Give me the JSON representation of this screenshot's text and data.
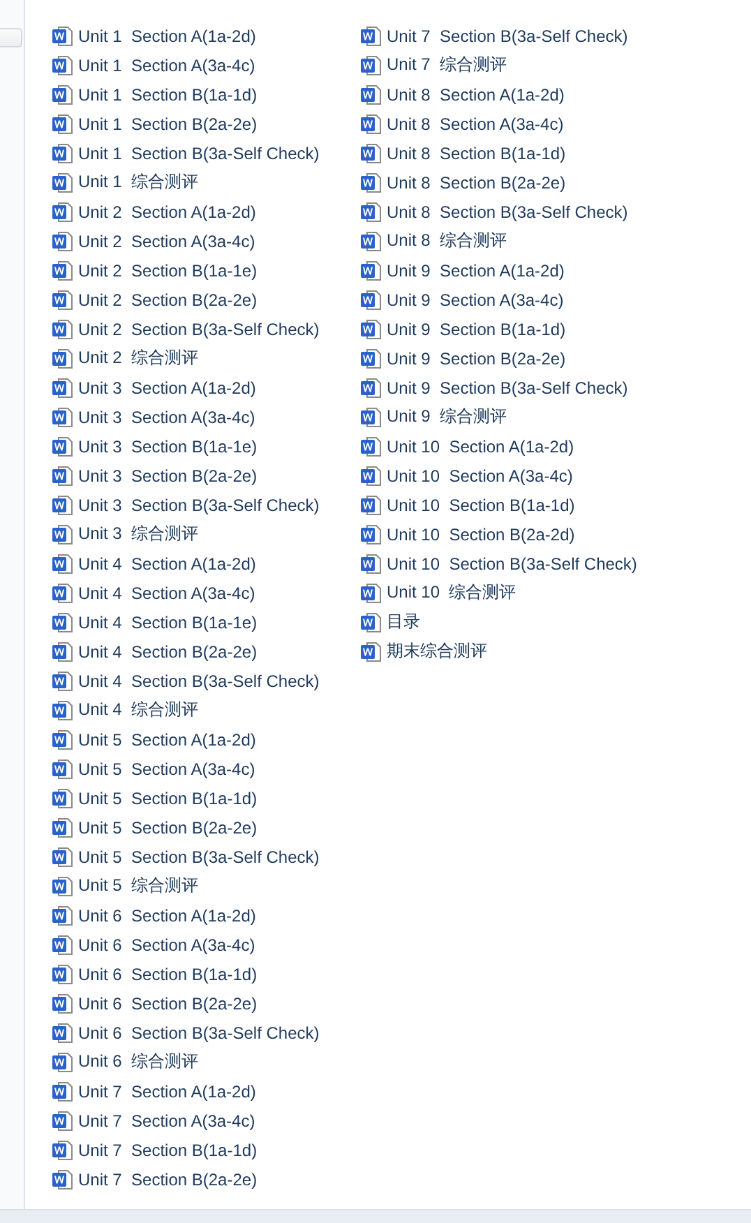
{
  "files": [
    {
      "name": "Unit 1  Section A(1a-2d)"
    },
    {
      "name": "Unit 1  Section A(3a-4c)"
    },
    {
      "name": "Unit 1  Section B(1a-1d)"
    },
    {
      "name": "Unit 1  Section B(2a-2e)"
    },
    {
      "name": "Unit 1  Section B(3a-Self Check)"
    },
    {
      "name": "Unit 1  综合测评"
    },
    {
      "name": "Unit 2  Section A(1a-2d)"
    },
    {
      "name": "Unit 2  Section A(3a-4c)"
    },
    {
      "name": "Unit 2  Section B(1a-1e)"
    },
    {
      "name": "Unit 2  Section B(2a-2e)"
    },
    {
      "name": "Unit 2  Section B(3a-Self Check)"
    },
    {
      "name": "Unit 2  综合测评"
    },
    {
      "name": "Unit 3  Section A(1a-2d)"
    },
    {
      "name": "Unit 3  Section A(3a-4c)"
    },
    {
      "name": "Unit 3  Section B(1a-1e)"
    },
    {
      "name": "Unit 3  Section B(2a-2e)"
    },
    {
      "name": "Unit 3  Section B(3a-Self Check)"
    },
    {
      "name": "Unit 3  综合测评"
    },
    {
      "name": "Unit 4  Section A(1a-2d)"
    },
    {
      "name": "Unit 4  Section A(3a-4c)"
    },
    {
      "name": "Unit 4  Section B(1a-1e)"
    },
    {
      "name": "Unit 4  Section B(2a-2e)"
    },
    {
      "name": "Unit 4  Section B(3a-Self Check)"
    },
    {
      "name": "Unit 4  综合测评"
    },
    {
      "name": "Unit 5  Section A(1a-2d)"
    },
    {
      "name": "Unit 5  Section A(3a-4c)"
    },
    {
      "name": "Unit 5  Section B(1a-1d)"
    },
    {
      "name": "Unit 5  Section B(2a-2e)"
    },
    {
      "name": "Unit 5  Section B(3a-Self Check)"
    },
    {
      "name": "Unit 5  综合测评"
    },
    {
      "name": "Unit 6  Section A(1a-2d)"
    },
    {
      "name": "Unit 6  Section A(3a-4c)"
    },
    {
      "name": "Unit 6  Section B(1a-1d)"
    },
    {
      "name": "Unit 6  Section B(2a-2e)"
    },
    {
      "name": "Unit 6  Section B(3a-Self Check)"
    },
    {
      "name": "Unit 6  综合测评"
    },
    {
      "name": "Unit 7  Section A(1a-2d)"
    },
    {
      "name": "Unit 7  Section A(3a-4c)"
    },
    {
      "name": "Unit 7  Section B(1a-1d)"
    },
    {
      "name": "Unit 7  Section B(2a-2e)"
    },
    {
      "name": "Unit 7  Section B(3a-Self Check)"
    },
    {
      "name": "Unit 7  综合测评"
    },
    {
      "name": "Unit 8  Section A(1a-2d)"
    },
    {
      "name": "Unit 8  Section A(3a-4c)"
    },
    {
      "name": "Unit 8  Section B(1a-1d)"
    },
    {
      "name": "Unit 8  Section B(2a-2e)"
    },
    {
      "name": "Unit 8  Section B(3a-Self Check)"
    },
    {
      "name": "Unit 8  综合测评"
    },
    {
      "name": "Unit 9  Section A(1a-2d)"
    },
    {
      "name": "Unit 9  Section A(3a-4c)"
    },
    {
      "name": "Unit 9  Section B(1a-1d)"
    },
    {
      "name": "Unit 9  Section B(2a-2e)"
    },
    {
      "name": "Unit 9  Section B(3a-Self Check)"
    },
    {
      "name": "Unit 9  综合测评"
    },
    {
      "name": "Unit 10  Section A(1a-2d)"
    },
    {
      "name": "Unit 10  Section A(3a-4c)"
    },
    {
      "name": "Unit 10  Section B(1a-1d)"
    },
    {
      "name": "Unit 10  Section B(2a-2d)"
    },
    {
      "name": "Unit 10  Section B(3a-Self Check)"
    },
    {
      "name": "Unit 10  综合测评"
    },
    {
      "name": "目录"
    },
    {
      "name": "期末综合测评"
    }
  ]
}
